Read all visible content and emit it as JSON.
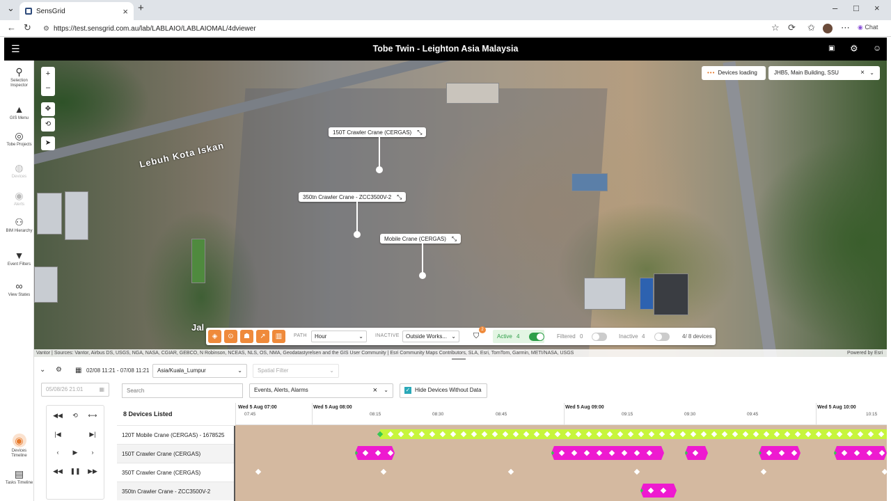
{
  "browser": {
    "tab_title": "SensGrid",
    "url": "https://test.sensgrid.com.au/lab/LABLAIO/LABLAIOMAL/4dviewer",
    "profile_chat": "Chat"
  },
  "app": {
    "title": "Tobe Twin - Leighton Asia Malaysia"
  },
  "sidebar": {
    "items": [
      {
        "label": "Selection Inspector",
        "icon": "search-icon"
      },
      {
        "label": "GIS Menu",
        "icon": "mountain-icon"
      },
      {
        "label": "Tobe Projects",
        "icon": "target-icon"
      },
      {
        "label": "Devices",
        "icon": "device-icon"
      },
      {
        "label": "Alerts",
        "icon": "alert-icon"
      },
      {
        "label": "BIM Hierarchy",
        "icon": "hierarchy-icon"
      },
      {
        "label": "Event Filters",
        "icon": "filter-icon"
      },
      {
        "label": "View States",
        "icon": "binoculars-icon"
      },
      {
        "label": "Devices Timeline",
        "icon": "timeline-icon"
      },
      {
        "label": "Tasks Timeline",
        "icon": "document-icon"
      }
    ]
  },
  "map": {
    "road_label_1": "Lebuh Kota Iskan",
    "road_label_2": "Jal",
    "devices_loading": "Devices loading",
    "location": "JHB5, Main Building, SSU",
    "callouts": [
      {
        "label": "150T Crawler Crane (CERGAS)"
      },
      {
        "label": "350tn Crawler Crane - ZCC3500V-2"
      },
      {
        "label": "Mobile Crane (CERGAS)"
      }
    ],
    "attribution": "Vantor | Sources: Vantor, Airbus DS, USGS, NGA, NASA, CGIAR, GEBCO, N Robinson, NCEAS, NLS, OS, NMA, Geodatastyrelsen and the GIS User Community | Esri Community Maps Contributors, SLA, Esri, TomTom, Garmin, METI/NASA, USGS",
    "powered_by": "Powered by Esri"
  },
  "toolbar": {
    "path_label": "PATH",
    "path_value": "Hour",
    "inactive_label": "INACTIVE",
    "inactive_value": "Outside Works...",
    "filter_badge": "2",
    "active_label": "Active",
    "active_count": "4",
    "filtered_label": "Filtered",
    "filtered_count": "0",
    "inactive2_label": "Inactive",
    "inactive2_count": "4",
    "devices_count": "4/ 8 devices"
  },
  "timeline": {
    "date_range": "02/08 11:21 - 07/08 11:21",
    "timezone": "Asia/Kuala_Lumpur",
    "spatial_filter": "Spatial Filter",
    "date_input": "05/08/26 21:01",
    "search_placeholder": "Search",
    "event_filter": "Events, Alerts, Alarms",
    "hide_devices": "Hide Devices Without Data",
    "devices_listed": "8 Devices Listed",
    "major_ticks": [
      "Wed 5 Aug 07:00",
      "Wed 5 Aug 08:00",
      "Wed 5 Aug 09:00",
      "Wed 5 Aug 10:00"
    ],
    "minor_ticks": [
      "07:45",
      "08:15",
      "08:30",
      "08:45",
      "09:15",
      "09:30",
      "09:45",
      "10:15"
    ],
    "devices": [
      {
        "name": "120T Mobile Crane (CERGAS) - 1678525"
      },
      {
        "name": "150T Crawler Crane (CERGAS)"
      },
      {
        "name": "350T Crawler Crane (CERGAS)"
      },
      {
        "name": "350tn Crawler Crane - ZCC3500V-2"
      }
    ]
  },
  "colors": {
    "accent": "#ef8a3b",
    "active_toggle": "#2e9e48",
    "lime": "#c7f53c",
    "magenta": "#ee1ad0",
    "lane": "#d4b9a0"
  }
}
